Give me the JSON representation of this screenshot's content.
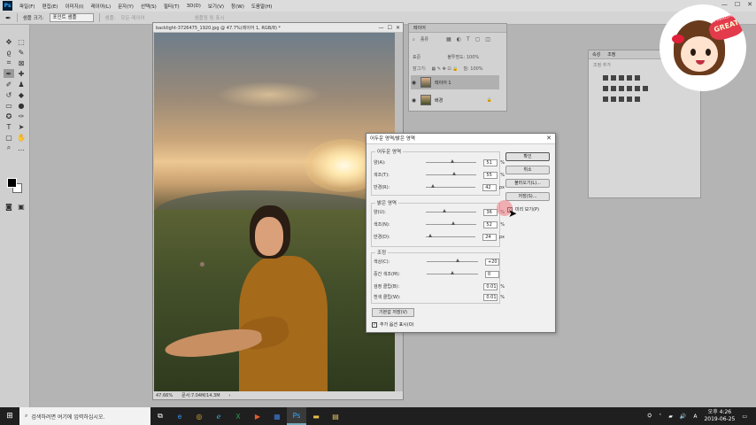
{
  "menubar": {
    "items": [
      "파일(F)",
      "편집(E)",
      "이미지(I)",
      "레이어(L)",
      "문자(Y)",
      "선택(S)",
      "필터(T)",
      "3D(D)",
      "보기(V)",
      "창(W)",
      "도움말(H)"
    ],
    "window_controls": [
      "—",
      "☐",
      "✕"
    ]
  },
  "optbar": {
    "sample_size_label": "샘플 크기:",
    "sample_size_value": "포인트 샘플",
    "sample_label": "샘플:",
    "sample_value": "모든 레이어",
    "show_ring": "샘플링 링 표시"
  },
  "document": {
    "title": "backlight-3726475_1920.jpg @ 47.7%(레이어 1, RGB/8) *",
    "controls": [
      "—",
      "☐",
      "✕"
    ],
    "zoom": "47.66%",
    "doc_size": "문서:7.04M/14.3M"
  },
  "layers_panel": {
    "tab": "레이어",
    "filter_label": "종류",
    "blend_mode": "표준",
    "opacity_label": "불투명도: 100%",
    "lock_label": "잠그기:",
    "fill_label": "칠: 100%",
    "layers": [
      {
        "name": "레이어 1",
        "selected": true
      },
      {
        "name": "배경",
        "selected": false,
        "locked": true
      }
    ]
  },
  "adj_panel": {
    "tabs": [
      "속성",
      "조정"
    ],
    "subtitle": "조정 추가"
  },
  "dialog": {
    "title": "어두운 영역/밝은 영역",
    "close": "✕",
    "shadows": {
      "label": "어두운 영역",
      "fields": [
        {
          "label": "양(A):",
          "value": "51",
          "unit": "%",
          "pos": 51
        },
        {
          "label": "색조(T):",
          "value": "55",
          "unit": "%",
          "pos": 55
        },
        {
          "label": "반경(R):",
          "value": "42",
          "unit": "px",
          "pos": 14
        }
      ]
    },
    "highlights": {
      "label": "밝은 영역",
      "fields": [
        {
          "label": "양(U):",
          "value": "36",
          "unit": "%",
          "pos": 36
        },
        {
          "label": "색조(N):",
          "value": "52",
          "unit": "%",
          "pos": 52
        },
        {
          "label": "반경(D):",
          "value": "24",
          "unit": "px",
          "pos": 8
        }
      ]
    },
    "adjustments": {
      "label": "조정",
      "fields": [
        {
          "label": "색상(C):",
          "value": "+20",
          "unit": "",
          "pos": 60
        },
        {
          "label": "중간 색조(M):",
          "value": "0",
          "unit": "",
          "pos": 50
        },
        {
          "label": "검정 클립(B):",
          "value": "0.01",
          "unit": "%",
          "pos": -1
        },
        {
          "label": "흰색 클립(W):",
          "value": "0.01",
          "unit": "%",
          "pos": -1
        }
      ]
    },
    "buttons": {
      "ok": "확인",
      "cancel": "취소",
      "load": "불러오기(L)...",
      "save": "저장(S)..."
    },
    "preview_label": "미리 보기(P)",
    "preview_checked": true,
    "save_default": "기본값 저장(V)",
    "more_options": "추가 옵션 표시(O)",
    "more_options_checked": true
  },
  "logo": {
    "ps": "Photoshop",
    "great": "GREAT"
  },
  "taskbar": {
    "search_placeholder": "검색하려면 여기에 입력하십시오.",
    "time": "오후 4:26",
    "date": "2019-06-25"
  }
}
